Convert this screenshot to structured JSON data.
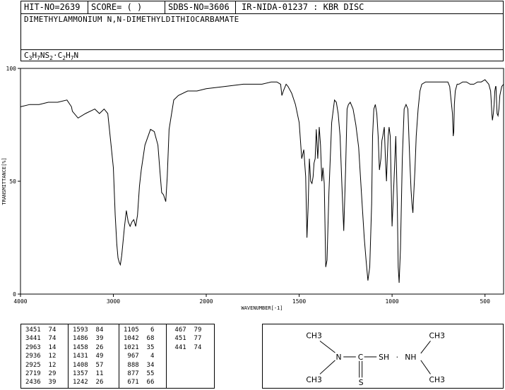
{
  "header": {
    "hit_no": "HIT-NO=2639",
    "score": "SCORE=  (   )",
    "sdbs_no": "SDBS-NO=3606",
    "ir_id": "IR-NIDA-01237 : KBR DISC",
    "compound_name": "DIMETHYLAMMONIUM N,N-DIMETHYLDITHIOCARBAMATE",
    "formula_parts": [
      {
        "t": "C"
      },
      {
        "t": "3",
        "sub": true
      },
      {
        "t": "H"
      },
      {
        "t": "7",
        "sub": true
      },
      {
        "t": "NS"
      },
      {
        "t": "2",
        "sub": true
      },
      {
        "t": "·C"
      },
      {
        "t": "2",
        "sub": true
      },
      {
        "t": "H"
      },
      {
        "t": "7",
        "sub": true
      },
      {
        "t": "N"
      }
    ]
  },
  "chart_data": {
    "type": "line",
    "xlabel": "WAVENUMBER[-1]",
    "ylabel": "TRANSMITTANCE[%]",
    "xlim": [
      4000,
      400
    ],
    "ylim": [
      0,
      100
    ],
    "x_ticks": [
      4000,
      3000,
      2000,
      1500,
      1000,
      500
    ],
    "x_tick_labels": [
      "4000",
      "3000",
      "2000",
      "1500",
      "1000",
      "500"
    ],
    "y_ticks": [
      0,
      50,
      100
    ],
    "y_tick_labels": [
      "0",
      "50",
      "100"
    ],
    "series": [
      {
        "x": [
          4000,
          3900,
          3800,
          3700,
          3600,
          3500,
          3451,
          3441,
          3380,
          3300,
          3200,
          3150,
          3100,
          3060,
          3030,
          3000,
          2980,
          2963,
          2950,
          2936,
          2925,
          2910,
          2880,
          2860,
          2840,
          2820,
          2800,
          2780,
          2760,
          2740,
          2719,
          2700,
          2660,
          2600,
          2560,
          2520,
          2500,
          2480,
          2460,
          2436,
          2420,
          2400,
          2350,
          2300,
          2200,
          2100,
          2000,
          1900,
          1800,
          1700,
          1650,
          1620,
          1600,
          1593,
          1585,
          1570,
          1560,
          1540,
          1520,
          1500,
          1486,
          1475,
          1465,
          1458,
          1452,
          1445,
          1438,
          1431,
          1425,
          1420,
          1414,
          1408,
          1400,
          1392,
          1385,
          1378,
          1372,
          1365,
          1357,
          1350,
          1340,
          1325,
          1310,
          1300,
          1290,
          1280,
          1270,
          1260,
          1250,
          1242,
          1235,
          1225,
          1210,
          1195,
          1180,
          1165,
          1150,
          1140,
          1130,
          1120,
          1110,
          1105,
          1098,
          1090,
          1082,
          1075,
          1068,
          1060,
          1055,
          1050,
          1042,
          1036,
          1030,
          1026,
          1021,
          1016,
          1010,
          1005,
          1000,
          990,
          980,
          972,
          967,
          962,
          955,
          945,
          935,
          925,
          915,
          905,
          898,
          893,
          888,
          883,
          877,
          870,
          860,
          850,
          840,
          820,
          800,
          780,
          760,
          740,
          720,
          700,
          690,
          680,
          675,
          671,
          668,
          665,
          660,
          650,
          640,
          620,
          600,
          580,
          560,
          540,
          520,
          500,
          490,
          480,
          470,
          467,
          463,
          460,
          455,
          451,
          447,
          443,
          441,
          438,
          435,
          430,
          425,
          420,
          410,
          400
        ],
        "y": [
          83,
          84,
          84,
          85,
          85,
          86,
          83,
          81,
          78,
          80,
          82,
          80,
          82,
          80,
          68,
          56,
          35,
          22,
          16,
          14,
          13,
          17,
          30,
          37,
          32,
          30,
          32,
          33,
          30,
          35,
          48,
          55,
          66,
          73,
          72,
          66,
          55,
          45,
          44,
          41,
          52,
          73,
          86,
          88,
          90,
          90,
          91,
          92,
          93,
          93,
          94,
          94,
          93,
          88,
          90,
          93,
          92,
          89,
          84,
          76,
          60,
          64,
          52,
          25,
          38,
          60,
          50,
          49,
          52,
          58,
          60,
          73,
          60,
          74,
          66,
          50,
          56,
          49,
          12,
          15,
          45,
          76,
          86,
          85,
          80,
          70,
          48,
          28,
          55,
          82,
          84,
          85,
          82,
          75,
          65,
          45,
          25,
          15,
          6,
          12,
          40,
          70,
          82,
          84,
          80,
          70,
          55,
          60,
          68,
          70,
          74,
          60,
          50,
          60,
          70,
          74,
          70,
          50,
          30,
          50,
          70,
          40,
          12,
          5,
          20,
          60,
          82,
          84,
          82,
          60,
          46,
          40,
          36,
          45,
          55,
          70,
          82,
          90,
          93,
          94,
          94,
          94,
          94,
          94,
          94,
          94,
          92,
          84,
          80,
          70,
          72,
          84,
          90,
          93,
          93,
          94,
          94,
          93,
          93,
          94,
          94,
          95,
          94,
          93,
          90,
          86,
          80,
          77,
          80,
          84,
          90,
          92,
          92,
          86,
          80,
          79,
          82,
          88,
          92,
          93
        ],
        "stroke": "#000000"
      }
    ],
    "grid": false
  },
  "peaks": [
    [
      [
        "3451",
        "74"
      ],
      [
        "3441",
        "74"
      ],
      [
        "2963",
        "14"
      ],
      [
        "2936",
        "12"
      ],
      [
        "2925",
        "12"
      ],
      [
        "2719",
        "29"
      ],
      [
        "2436",
        "39"
      ]
    ],
    [
      [
        "1593",
        "84"
      ],
      [
        "1486",
        "39"
      ],
      [
        "1458",
        "26"
      ],
      [
        "1431",
        "49"
      ],
      [
        "1408",
        "57"
      ],
      [
        "1357",
        "11"
      ],
      [
        "1242",
        "26"
      ]
    ],
    [
      [
        "1105",
        "6"
      ],
      [
        "1042",
        "68"
      ],
      [
        "1021",
        "35"
      ],
      [
        "967",
        "4"
      ],
      [
        "888",
        "34"
      ],
      [
        "877",
        "55"
      ],
      [
        "671",
        "66"
      ]
    ],
    [
      [
        "467",
        "79"
      ],
      [
        "451",
        "77"
      ],
      [
        "441",
        "74"
      ]
    ]
  ],
  "structure": {
    "left_top": "CH3",
    "left_bottom": "CH3",
    "n_left": "N",
    "c_center": "C",
    "sh": "SH",
    "dot": "·",
    "nh": "NH",
    "right_top": "CH3",
    "right_bottom": "CH3",
    "s_bottom": "S"
  }
}
